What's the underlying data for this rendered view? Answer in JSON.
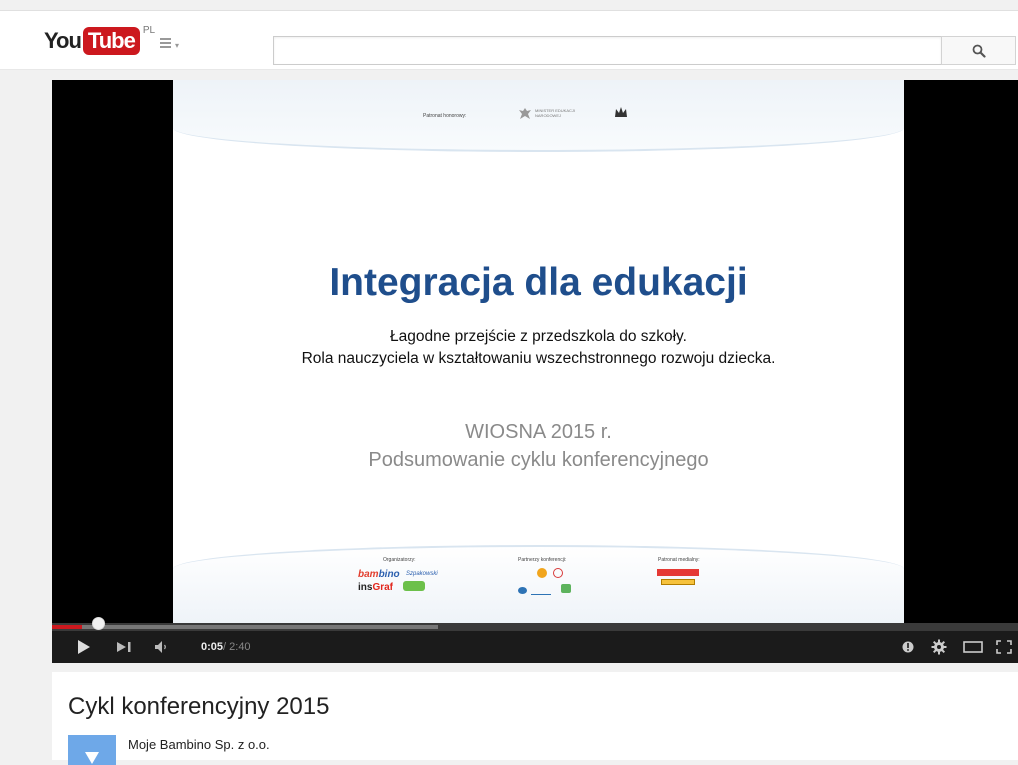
{
  "masthead": {
    "logo_you": "You",
    "logo_tube": "Tube",
    "country": "PL",
    "guide_caret": "▾",
    "search_value": "",
    "search_placeholder": ""
  },
  "slide": {
    "patronat": "Patronat honorowy:",
    "ministry": "MINISTER EDUKACJI NARODOWEJ",
    "title": "Integracja dla edukacji",
    "subtitle_line1": "Łagodne przejście z przedszkola do szkoły.",
    "subtitle_line2": "Rola nauczyciela w kształtowaniu wszechstronnego rozwoju dziecka.",
    "season": "WIOSNA 2015 r.",
    "summary": "Podsumowanie cyklu konferencyjnego",
    "organizers_label": "Organizatorzy:",
    "partners_label": "Partnerzy konferencji:",
    "media_label": "Patronat medialny:",
    "logo_bambino_b": "bam",
    "logo_bambino_rest": "bino",
    "logo_szkola": "Szpakowski",
    "logo_insgraf_a": "ins",
    "logo_insgraf_b": "Graf"
  },
  "player": {
    "current_time": "0:05",
    "duration": " / 2:40",
    "played_fraction": 0.031,
    "loaded_fraction": 0.4
  },
  "video": {
    "title": "Cykl konferencyjny 2015",
    "channel": "Moje Bambino Sp. z o.o."
  },
  "colors": {
    "brand_red": "#cc181e",
    "slide_title_blue": "#1f4e8c"
  },
  "icons": [
    "menu-icon",
    "search-icon",
    "play-icon",
    "next-icon",
    "volume-icon",
    "annotations-icon",
    "settings-icon",
    "theater-icon",
    "fullscreen-icon"
  ]
}
